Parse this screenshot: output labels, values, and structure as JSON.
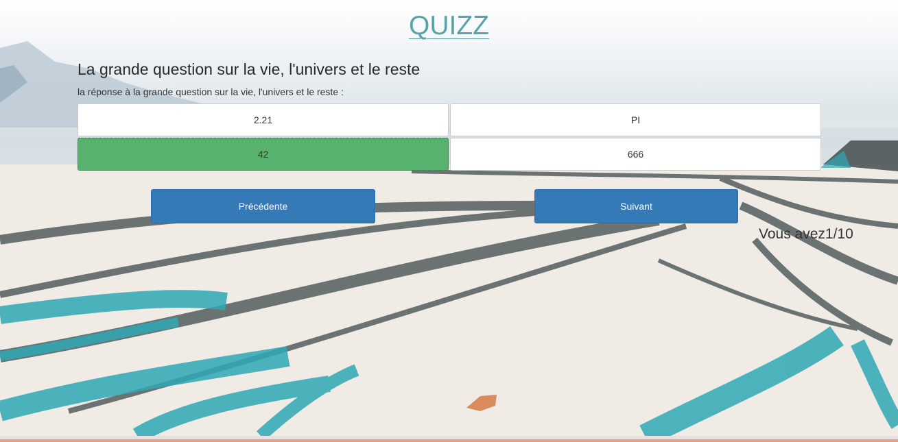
{
  "quiz": {
    "title": "QUIZZ",
    "question": "La grande question sur la vie, l'univers et le reste",
    "subtitle": "la réponse à la grande question sur la vie, l'univers et le reste :",
    "answers": [
      {
        "label": "2.21",
        "selected": false
      },
      {
        "label": "PI",
        "selected": false
      },
      {
        "label": "42",
        "selected": true
      },
      {
        "label": "666",
        "selected": false
      }
    ],
    "previous_label": "Précédente",
    "next_label": "Suivant",
    "score_text": "Vous avez1/10"
  },
  "colors": {
    "title": "#5aa4a8",
    "selected_answer": "#56b26d",
    "button": "#337ab7",
    "bottom_line": "#e8a089"
  }
}
